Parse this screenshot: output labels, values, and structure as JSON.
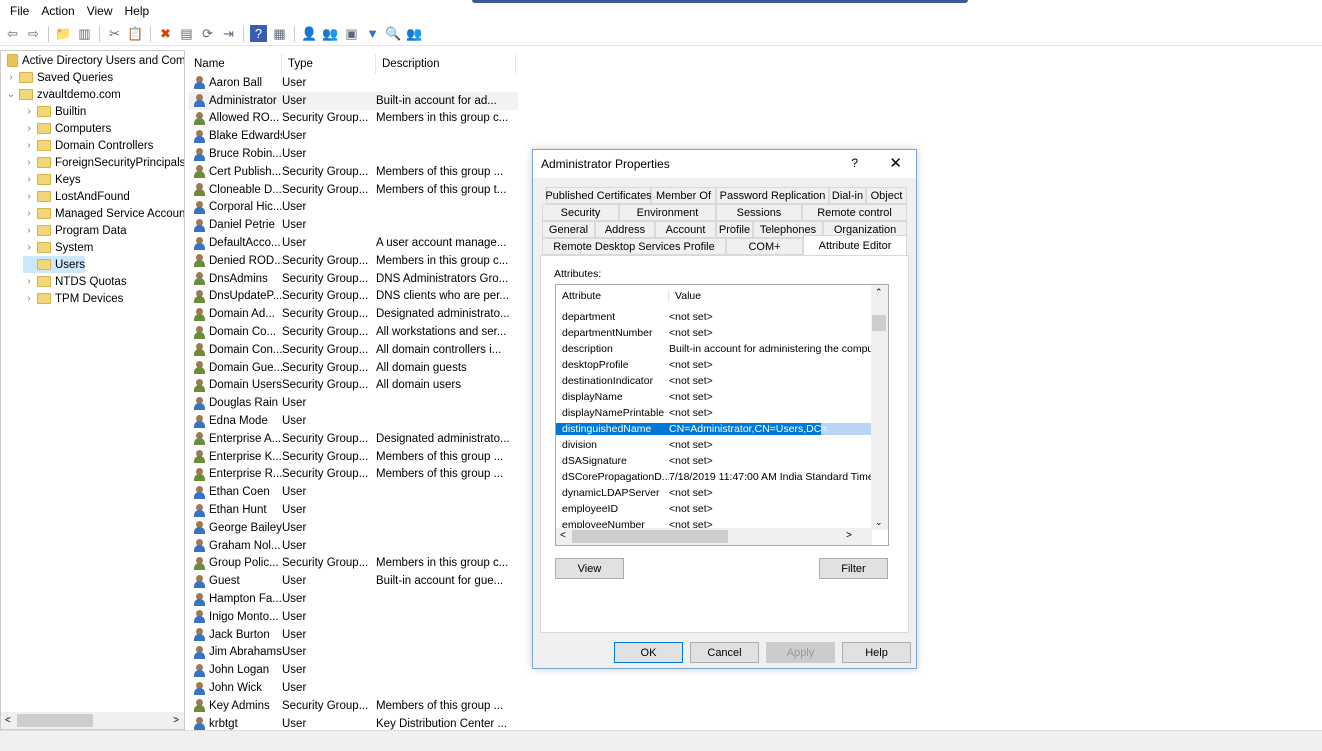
{
  "menu": [
    "File",
    "Action",
    "View",
    "Help"
  ],
  "toolbar_icons": [
    "back-icon",
    "forward-icon",
    "up-folder-icon",
    "show-tree-icon",
    "cut-icon",
    "paste-icon",
    "delete-icon",
    "properties-icon",
    "refresh-icon",
    "export-icon",
    "help-icon",
    "console-icon",
    "new-user-icon",
    "new-group-icon",
    "new-ou-icon",
    "filter-icon",
    "find-icon",
    "add-to-group-icon"
  ],
  "tree": {
    "root": "Active Directory Users and Com",
    "items": [
      {
        "label": "Saved Queries",
        "level": 1,
        "exp": ">"
      },
      {
        "label": "zvaultdemo.com",
        "level": 1,
        "exp": "v"
      },
      {
        "label": "Builtin",
        "level": 2,
        "exp": ">"
      },
      {
        "label": "Computers",
        "level": 2,
        "exp": ">"
      },
      {
        "label": "Domain Controllers",
        "level": 2,
        "exp": ">"
      },
      {
        "label": "ForeignSecurityPrincipals",
        "level": 2,
        "exp": ">"
      },
      {
        "label": "Keys",
        "level": 2,
        "exp": ">"
      },
      {
        "label": "LostAndFound",
        "level": 2,
        "exp": ">"
      },
      {
        "label": "Managed Service Accoun",
        "level": 2,
        "exp": ">"
      },
      {
        "label": "Program Data",
        "level": 2,
        "exp": ">"
      },
      {
        "label": "System",
        "level": 2,
        "exp": ">"
      },
      {
        "label": "Users",
        "level": 2,
        "exp": ""
      },
      {
        "label": "NTDS Quotas",
        "level": 2,
        "exp": ">"
      },
      {
        "label": "TPM Devices",
        "level": 2,
        "exp": ">"
      }
    ]
  },
  "list": {
    "headers": [
      "Name",
      "Type",
      "Description"
    ],
    "rows": [
      [
        "Aaron Ball",
        "User",
        ""
      ],
      [
        "Administrator",
        "User",
        "Built-in account for ad..."
      ],
      [
        "Allowed RO...",
        "Security Group...",
        "Members in this group c..."
      ],
      [
        "Blake Edwards",
        "User",
        ""
      ],
      [
        "Bruce Robin...",
        "User",
        ""
      ],
      [
        "Cert Publish...",
        "Security Group...",
        "Members of this group ..."
      ],
      [
        "Cloneable D...",
        "Security Group...",
        "Members of this group t..."
      ],
      [
        "Corporal Hic...",
        "User",
        ""
      ],
      [
        "Daniel Petrie",
        "User",
        ""
      ],
      [
        "DefaultAcco...",
        "User",
        "A user account manage..."
      ],
      [
        "Denied ROD...",
        "Security Group...",
        "Members in this group c..."
      ],
      [
        "DnsAdmins",
        "Security Group...",
        "DNS Administrators Gro..."
      ],
      [
        "DnsUpdateP...",
        "Security Group...",
        "DNS clients who are per..."
      ],
      [
        "Domain Ad...",
        "Security Group...",
        "Designated administrato..."
      ],
      [
        "Domain Co...",
        "Security Group...",
        "All workstations and ser..."
      ],
      [
        "Domain Con...",
        "Security Group...",
        "All domain controllers i..."
      ],
      [
        "Domain Gue...",
        "Security Group...",
        "All domain guests"
      ],
      [
        "Domain Users",
        "Security Group...",
        "All domain users"
      ],
      [
        "Douglas Rain",
        "User",
        ""
      ],
      [
        "Edna Mode",
        "User",
        ""
      ],
      [
        "Enterprise A...",
        "Security Group...",
        "Designated administrato..."
      ],
      [
        "Enterprise K...",
        "Security Group...",
        "Members of this group ..."
      ],
      [
        "Enterprise R...",
        "Security Group...",
        "Members of this group ..."
      ],
      [
        "Ethan Coen",
        "User",
        ""
      ],
      [
        "Ethan Hunt",
        "User",
        ""
      ],
      [
        "George Bailey",
        "User",
        ""
      ],
      [
        "Graham Nol...",
        "User",
        ""
      ],
      [
        "Group Polic...",
        "Security Group...",
        "Members in this group c..."
      ],
      [
        "Guest",
        "User",
        "Built-in account for gue..."
      ],
      [
        "Hampton Fa...",
        "User",
        ""
      ],
      [
        "Inigo Monto...",
        "User",
        ""
      ],
      [
        "Jack Burton",
        "User",
        ""
      ],
      [
        "Jim Abrahams",
        "User",
        ""
      ],
      [
        "John Logan",
        "User",
        ""
      ],
      [
        "John Wick",
        "User",
        ""
      ],
      [
        "Key Admins",
        "Security Group...",
        "Members of this group ..."
      ],
      [
        "krbtgt",
        "User",
        "Key Distribution Center ..."
      ]
    ]
  },
  "dialog": {
    "title": "Administrator Properties",
    "help": "?",
    "close": "✕",
    "tabs_row1": [
      "Published Certificates",
      "Member Of",
      "Password Replication",
      "Dial-in",
      "Object"
    ],
    "tabs_row2": [
      "Security",
      "Environment",
      "Sessions",
      "Remote control"
    ],
    "tabs_row3": [
      "General",
      "Address",
      "Account",
      "Profile",
      "Telephones",
      "Organization"
    ],
    "tabs_row4": [
      "Remote Desktop Services Profile",
      "COM+",
      "Attribute Editor"
    ],
    "attributes_label": "Attributes:",
    "col_attr": "Attribute",
    "col_value": "Value",
    "rows": [
      [
        "department",
        "<not set>"
      ],
      [
        "departmentNumber",
        "<not set>"
      ],
      [
        "description",
        "Built-in account for administering the computer/domain"
      ],
      [
        "desktopProfile",
        "<not set>"
      ],
      [
        "destinationIndicator",
        "<not set>"
      ],
      [
        "displayName",
        "<not set>"
      ],
      [
        "displayNamePrintable",
        "<not set>"
      ],
      [
        "distinguishedName",
        "CN=Administrator,CN=Users,DC="
      ],
      [
        "division",
        "<not set>"
      ],
      [
        "dSASignature",
        "<not set>"
      ],
      [
        "dSCorePropagationD...",
        "7/18/2019 11:47:00 AM India Standard Time"
      ],
      [
        "dynamicLDAPServer",
        "<not set>"
      ],
      [
        "employeeID",
        "<not set>"
      ],
      [
        "employeeNumber",
        "<not set>"
      ]
    ],
    "selected_row": 7,
    "view": "View",
    "filter": "Filter",
    "ok": "OK",
    "cancel": "Cancel",
    "apply": "Apply",
    "helpbtn": "Help"
  }
}
